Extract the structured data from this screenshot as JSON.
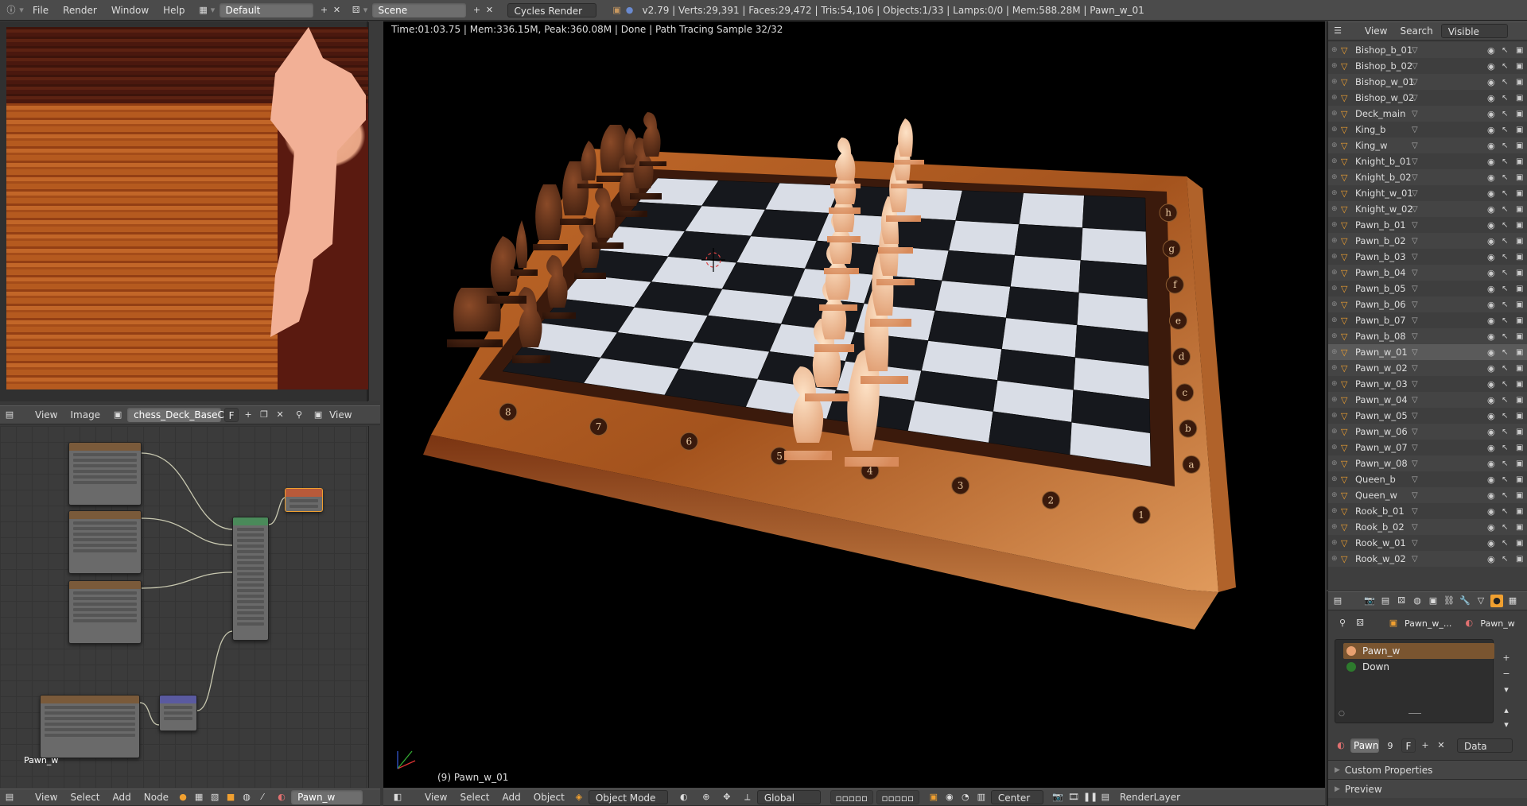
{
  "topbar": {
    "info_icon": "info-icon",
    "menus": [
      "File",
      "Render",
      "Window",
      "Help"
    ],
    "layout_value": "Default",
    "scene_value": "Scene",
    "engine_value": "Cycles Render",
    "stats": "v2.79 | Verts:29,391 | Faces:29,472 | Tris:54,106 | Objects:1/33 | Lamps:0/0 | Mem:588.28M | Pawn_w_01"
  },
  "image_editor": {
    "menus": [
      "View",
      "Image"
    ],
    "image_name": "chess_Deck_BaseC...",
    "fake_user": "F",
    "view_label": "View"
  },
  "node_editor": {
    "material_label": "Pawn_w",
    "menus": [
      "View",
      "Select",
      "Add",
      "Node"
    ],
    "material_field": "Pawn_w"
  },
  "viewport": {
    "render_info": "Time:01:03.75 | Mem:336.15M, Peak:360.08M | Done | Path Tracing Sample 32/32",
    "object_label": "(9) Pawn_w_01",
    "board_files": [
      "a",
      "b",
      "c",
      "d",
      "e",
      "f",
      "g",
      "h"
    ],
    "board_ranks": [
      "1",
      "2",
      "3",
      "4",
      "5",
      "6",
      "7",
      "8"
    ],
    "menus": [
      "View",
      "Select",
      "Add",
      "Object"
    ],
    "mode": "Object Mode",
    "orientation": "Global",
    "pivot": "Center",
    "render_layer": "RenderLayer"
  },
  "outliner": {
    "menus": [
      "View",
      "Search"
    ],
    "filter": "Visible Layers",
    "items": [
      {
        "label": "Bishop_b_01"
      },
      {
        "label": "Bishop_b_02"
      },
      {
        "label": "Bishop_w_01"
      },
      {
        "label": "Bishop_w_02"
      },
      {
        "label": "Deck_main"
      },
      {
        "label": "King_b"
      },
      {
        "label": "King_w"
      },
      {
        "label": "Knight_b_01"
      },
      {
        "label": "Knight_b_02"
      },
      {
        "label": "Knight_w_01"
      },
      {
        "label": "Knight_w_02"
      },
      {
        "label": "Pawn_b_01"
      },
      {
        "label": "Pawn_b_02"
      },
      {
        "label": "Pawn_b_03"
      },
      {
        "label": "Pawn_b_04"
      },
      {
        "label": "Pawn_b_05"
      },
      {
        "label": "Pawn_b_06"
      },
      {
        "label": "Pawn_b_07"
      },
      {
        "label": "Pawn_b_08"
      },
      {
        "label": "Pawn_w_01"
      },
      {
        "label": "Pawn_w_02"
      },
      {
        "label": "Pawn_w_03"
      },
      {
        "label": "Pawn_w_04"
      },
      {
        "label": "Pawn_w_05"
      },
      {
        "label": "Pawn_w_06"
      },
      {
        "label": "Pawn_w_07"
      },
      {
        "label": "Pawn_w_08"
      },
      {
        "label": "Queen_b"
      },
      {
        "label": "Queen_w"
      },
      {
        "label": "Rook_b_01"
      },
      {
        "label": "Rook_b_02"
      },
      {
        "label": "Rook_w_01"
      },
      {
        "label": "Rook_w_02"
      }
    ],
    "selected": "Pawn_w_01"
  },
  "properties": {
    "context_object": "Pawn_w_...",
    "context_material": "Pawn_w",
    "slots": [
      {
        "label": "Pawn_w",
        "color": "#e8a070"
      },
      {
        "label": "Down",
        "color": "#2d7a2d"
      }
    ],
    "material_field": "Pawn",
    "users": "9",
    "fake_user": "F",
    "link": "Data",
    "panels": [
      "Custom Properties",
      "Preview"
    ]
  },
  "colors": {
    "accent_orange": "#f0a030",
    "selection_highlight": "#7a5530",
    "header_bg": "#474747"
  }
}
